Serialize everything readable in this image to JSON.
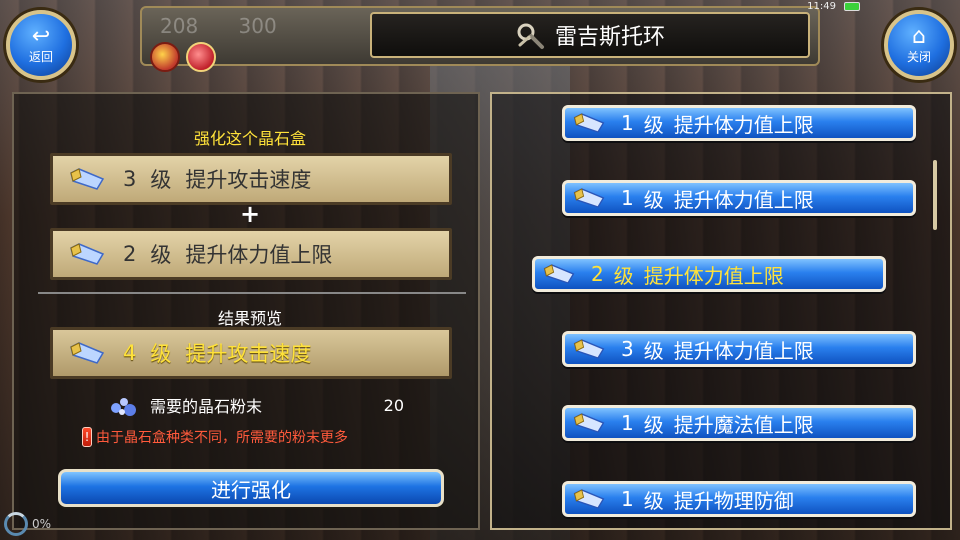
{
  "status": {
    "time": "11:49"
  },
  "header": {
    "title": "雷吉斯托环",
    "faded_numbers": [
      "208",
      "300"
    ],
    "back_label": "返回",
    "close_label": "关闭"
  },
  "left": {
    "enhance_title": "强化这个晶石盒",
    "slot1": {
      "level": "3",
      "unit": "级",
      "name": "提升攻击速度"
    },
    "plus": "+",
    "slot2": {
      "level": "2",
      "unit": "级",
      "name": "提升体力值上限"
    },
    "preview_title": "结果预览",
    "result": {
      "level": "4",
      "unit": "级",
      "name": "提升攻击速度"
    },
    "powder_label": "需要的晶石粉末",
    "powder_count": "20",
    "warning": "由于晶石盒种类不同，所需要的粉末更多",
    "enhance_button": "进行强化",
    "progress": "0%"
  },
  "right": {
    "items": [
      {
        "level": "1",
        "unit": "级",
        "name": "提升体力值上限"
      },
      {
        "level": "1",
        "unit": "级",
        "name": "提升体力值上限"
      },
      {
        "level": "2",
        "unit": "级",
        "name": "提升体力值上限"
      },
      {
        "level": "3",
        "unit": "级",
        "name": "提升体力值上限"
      },
      {
        "level": "1",
        "unit": "级",
        "name": "提升魔法值上限"
      },
      {
        "level": "1",
        "unit": "级",
        "name": "提升物理防御"
      }
    ]
  },
  "colors": {
    "accent_yellow": "#ffe23a",
    "button_blue": "#2a80ee",
    "warning_red": "#ff5a3c"
  }
}
